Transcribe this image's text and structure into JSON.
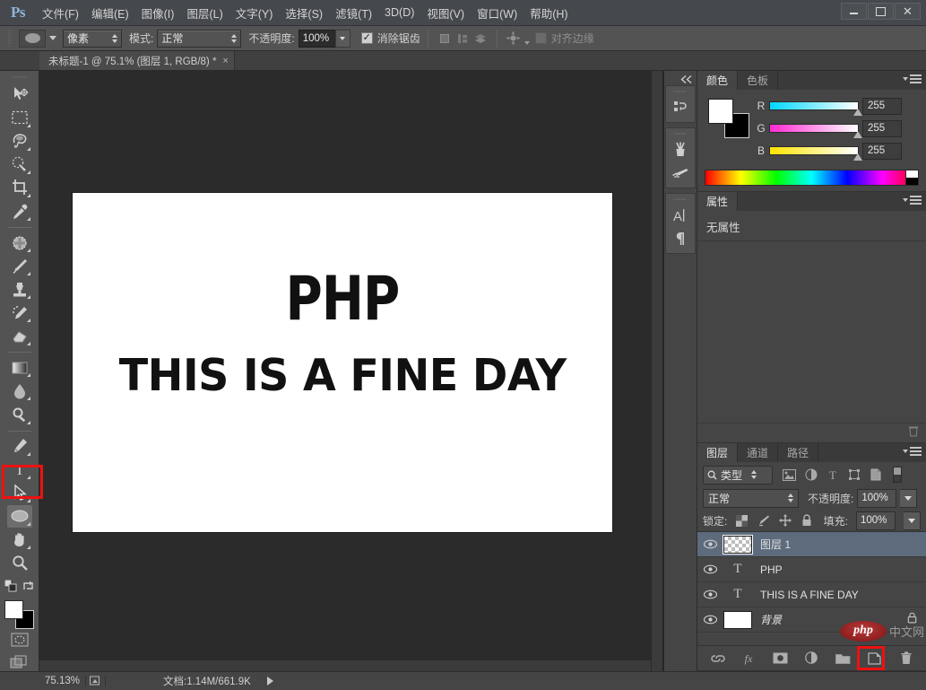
{
  "app": {
    "logo": "Ps",
    "menus": [
      {
        "label": "文件(F)"
      },
      {
        "label": "编辑(E)"
      },
      {
        "label": "图像(I)"
      },
      {
        "label": "图层(L)"
      },
      {
        "label": "文字(Y)"
      },
      {
        "label": "选择(S)"
      },
      {
        "label": "滤镜(T)"
      },
      {
        "label": "3D(D)"
      },
      {
        "label": "视图(V)"
      },
      {
        "label": "窗口(W)"
      },
      {
        "label": "帮助(H)"
      }
    ],
    "window_controls": {
      "minimize": "–",
      "maximize": "□",
      "close": "✕"
    }
  },
  "options_bar": {
    "tool_preset": "ellipse-shape",
    "draw_mode": "像素",
    "mode_label": "模式:",
    "blend_mode": "正常",
    "opacity_label": "不透明度:",
    "opacity_value": "100%",
    "antialias_label": "消除锯齿",
    "antialias_checked": true,
    "align_edges_label": "对齐边缘",
    "align_edges_checked": false
  },
  "document": {
    "tab_title": "未标题-1 @ 75.1% (图层 1, RGB/8) *",
    "close_glyph": "×",
    "canvas_text_line1": "PHP",
    "canvas_text_line2": "THIS IS A FINE DAY"
  },
  "toolbar": {
    "tools": [
      {
        "name": "move-tool",
        "active": false
      },
      {
        "name": "rectangular-marquee-tool",
        "active": false
      },
      {
        "name": "lasso-tool",
        "active": false
      },
      {
        "name": "quick-selection-tool",
        "active": false
      },
      {
        "name": "crop-tool",
        "active": false
      },
      {
        "name": "eyedropper-tool",
        "active": false
      },
      {
        "name": "spot-healing-brush-tool",
        "active": false
      },
      {
        "name": "brush-tool",
        "active": false
      },
      {
        "name": "clone-stamp-tool",
        "active": false
      },
      {
        "name": "history-brush-tool",
        "active": false
      },
      {
        "name": "eraser-tool",
        "active": false
      },
      {
        "name": "gradient-tool",
        "active": false
      },
      {
        "name": "blur-tool",
        "active": false
      },
      {
        "name": "dodge-tool",
        "active": false
      },
      {
        "name": "pen-tool",
        "active": false
      },
      {
        "name": "horizontal-type-tool",
        "active": false
      },
      {
        "name": "path-selection-tool",
        "active": false
      },
      {
        "name": "ellipse-tool",
        "active": true
      },
      {
        "name": "hand-tool",
        "active": false
      },
      {
        "name": "zoom-tool",
        "active": false
      }
    ],
    "foreground_color": "#ffffff",
    "background_color": "#000000"
  },
  "annotations": {
    "tool_highlight_color": "#ee1111",
    "new_layer_highlight_color": "#ee1111"
  },
  "mini_dock": {
    "collapse_glyph": "◀◀",
    "items": [
      {
        "name": "history-panel-icon"
      },
      {
        "name": "brush-presets-panel-icon"
      },
      {
        "name": "brush-panel-icon"
      },
      {
        "name": "character-panel-icon",
        "glyph": "A"
      },
      {
        "name": "paragraph-panel-icon",
        "glyph": "¶"
      }
    ]
  },
  "color_panel": {
    "tabs": [
      {
        "label": "颜色",
        "active": true
      },
      {
        "label": "色板",
        "active": false
      }
    ],
    "channels": [
      {
        "label": "R",
        "value": "255"
      },
      {
        "label": "G",
        "value": "255"
      },
      {
        "label": "B",
        "value": "255"
      }
    ]
  },
  "properties_panel": {
    "tabs": [
      {
        "label": "属性",
        "active": true
      }
    ],
    "empty_text": "无属性"
  },
  "layers_panel": {
    "tabs": [
      {
        "label": "图层",
        "active": true
      },
      {
        "label": "通道",
        "active": false
      },
      {
        "label": "路径",
        "active": false
      }
    ],
    "filter_type": "类型",
    "blend_mode": "正常",
    "opacity_label": "不透明度:",
    "opacity_value": "100%",
    "lock_label": "锁定:",
    "fill_label": "填充:",
    "fill_value": "100%",
    "layers": [
      {
        "name": "图层 1",
        "type": "pixel",
        "visible": true,
        "selected": true,
        "locked": false
      },
      {
        "name": "PHP",
        "type": "text",
        "visible": true,
        "selected": false,
        "locked": false
      },
      {
        "name": "THIS IS A FINE DAY",
        "type": "text",
        "visible": true,
        "selected": false,
        "locked": false
      },
      {
        "name": "背景",
        "type": "background",
        "visible": true,
        "selected": false,
        "locked": true
      }
    ],
    "footer_buttons": [
      {
        "name": "link-layers-button"
      },
      {
        "name": "layer-style-button",
        "glyph": "fx"
      },
      {
        "name": "layer-mask-button"
      },
      {
        "name": "adjustment-layer-button"
      },
      {
        "name": "new-group-button"
      },
      {
        "name": "new-layer-button"
      },
      {
        "name": "delete-layer-button"
      }
    ]
  },
  "watermark": {
    "logo_text": "php",
    "site_text": "中文网"
  },
  "status_bar": {
    "zoom": "75.13%",
    "doc_info": "文档:1.14M/661.9K"
  }
}
